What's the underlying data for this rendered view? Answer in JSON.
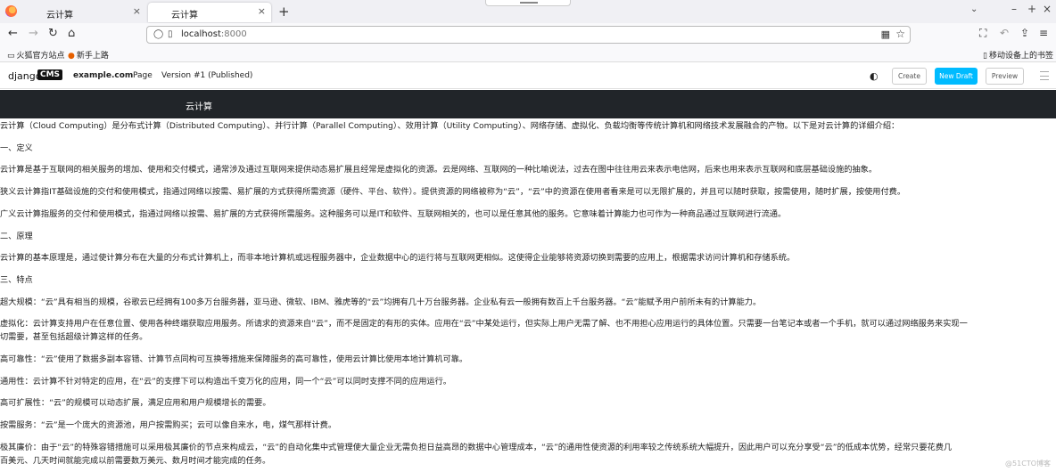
{
  "browser": {
    "tabs": [
      {
        "title": "云计算",
        "close": "×"
      },
      {
        "title": "云计算",
        "close": "×"
      }
    ],
    "new_tab": "+",
    "tab_list": "⌄",
    "window_controls": [
      "–",
      "+",
      "×"
    ],
    "url_host": "localhost",
    "url_port": ":8000",
    "bookmarks": [
      "火狐官方站点",
      "新手上路"
    ],
    "mobile_bookmarks": "移动设备上的书签"
  },
  "cms_toolbar": {
    "logo_text": "django",
    "logo_box": "CMS",
    "site": "example.com",
    "menu_page": "Page",
    "version": "Version #1 (Published)",
    "create": "Create",
    "new_draft": "New Draft",
    "preview": "Preview"
  },
  "page": {
    "header_title": "云计算",
    "paragraphs": [
      "云计算（Cloud Computing）是分布式计算（Distributed Computing）、并行计算（Parallel Computing）、效用计算（Utility Computing）、网络存储、虚拟化、负载均衡等传统计算机和网络技术发展融合的产物。以下是对云计算的详细介绍：",
      "一、定义",
      "云计算是基于互联网的相关服务的增加、使用和交付模式，通常涉及通过互联网来提供动态易扩展且经常是虚拟化的资源。云是网络、互联网的一种比喻说法，过去在图中往往用云来表示电信网，后来也用来表示互联网和底层基础设施的抽象。",
      "狭义云计算指IT基础设施的交付和使用模式，指通过网络以按需、易扩展的方式获得所需资源（硬件、平台、软件）。提供资源的网络被称为“云”，“云”中的资源在使用者看来是可以无限扩展的，并且可以随时获取，按需使用，随时扩展，按使用付费。",
      "广义云计算指服务的交付和使用模式，指通过网络以按需、易扩展的方式获得所需服务。这种服务可以是IT和软件、互联网相关的，也可以是任意其他的服务。它意味着计算能力也可作为一种商品通过互联网进行流通。",
      "二、原理",
      "云计算的基本原理是，通过使计算分布在大量的分布式计算机上，而非本地计算机或远程服务器中，企业数据中心的运行将与互联网更相似。这使得企业能够将资源切换到需要的应用上，根据需求访问计算机和存储系统。",
      "三、特点",
      "超大规模：“云”具有相当的规模，谷歌云已经拥有100多万台服务器，亚马逊、微软、IBM、雅虎等的“云”均拥有几十万台服务器。企业私有云一般拥有数百上千台服务器。“云”能赋予用户前所未有的计算能力。",
      "虚拟化：云计算支持用户在任意位置、使用各种终端获取应用服务。所请求的资源来自“云”，而不是固定的有形的实体。应用在“云”中某处运行，但实际上用户无需了解、也不用担心应用运行的具体位置。只需要一台笔记本或者一个手机，就可以通过网络服务来实现一",
      "切需要，甚至包括超级计算这样的任务。",
      "高可靠性：“云”使用了数据多副本容错、计算节点同构可互换等措施来保障服务的高可靠性，使用云计算比使用本地计算机可靠。",
      "通用性：云计算不针对特定的应用，在“云”的支撑下可以构造出千变万化的应用，同一个“云”可以同时支撑不同的应用运行。",
      "高可扩展性：“云”的规模可以动态扩展，满足应用和用户规模增长的需要。",
      "按需服务：“云”是一个庞大的资源池，用户按需购买；云可以像自来水，电，煤气那样计费。",
      "极其廉价：由于“云”的特殊容错措施可以采用极其廉价的节点来构成云，“云”的自动化集中式管理使大量企业无需负担日益高昂的数据中心管理成本，“云”的通用性使资源的利用率较之传统系统大幅提升，因此用户可以充分享受“云”的低成本优势，经常只要花费几",
      "百美元、几天时间就能完成以前需要数万美元、数月时间才能完成的任务。"
    ],
    "watermark": "@51CTO博客"
  }
}
